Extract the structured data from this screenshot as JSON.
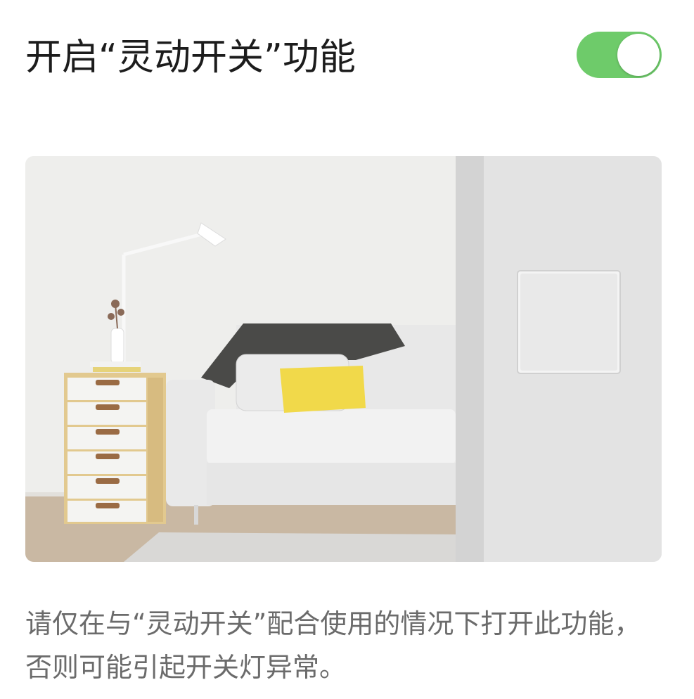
{
  "header": {
    "title": "开启“灵动开关”功能"
  },
  "toggle": {
    "state": "on",
    "accent_color": "#6ecb6a"
  },
  "illustration": {
    "subject": "living room with sofa, dresser, lamp and wall switch"
  },
  "description": {
    "text": "请仅在与“灵动开关”配合使用的情况下打开此功能，否则可能引起开关灯异常。"
  }
}
